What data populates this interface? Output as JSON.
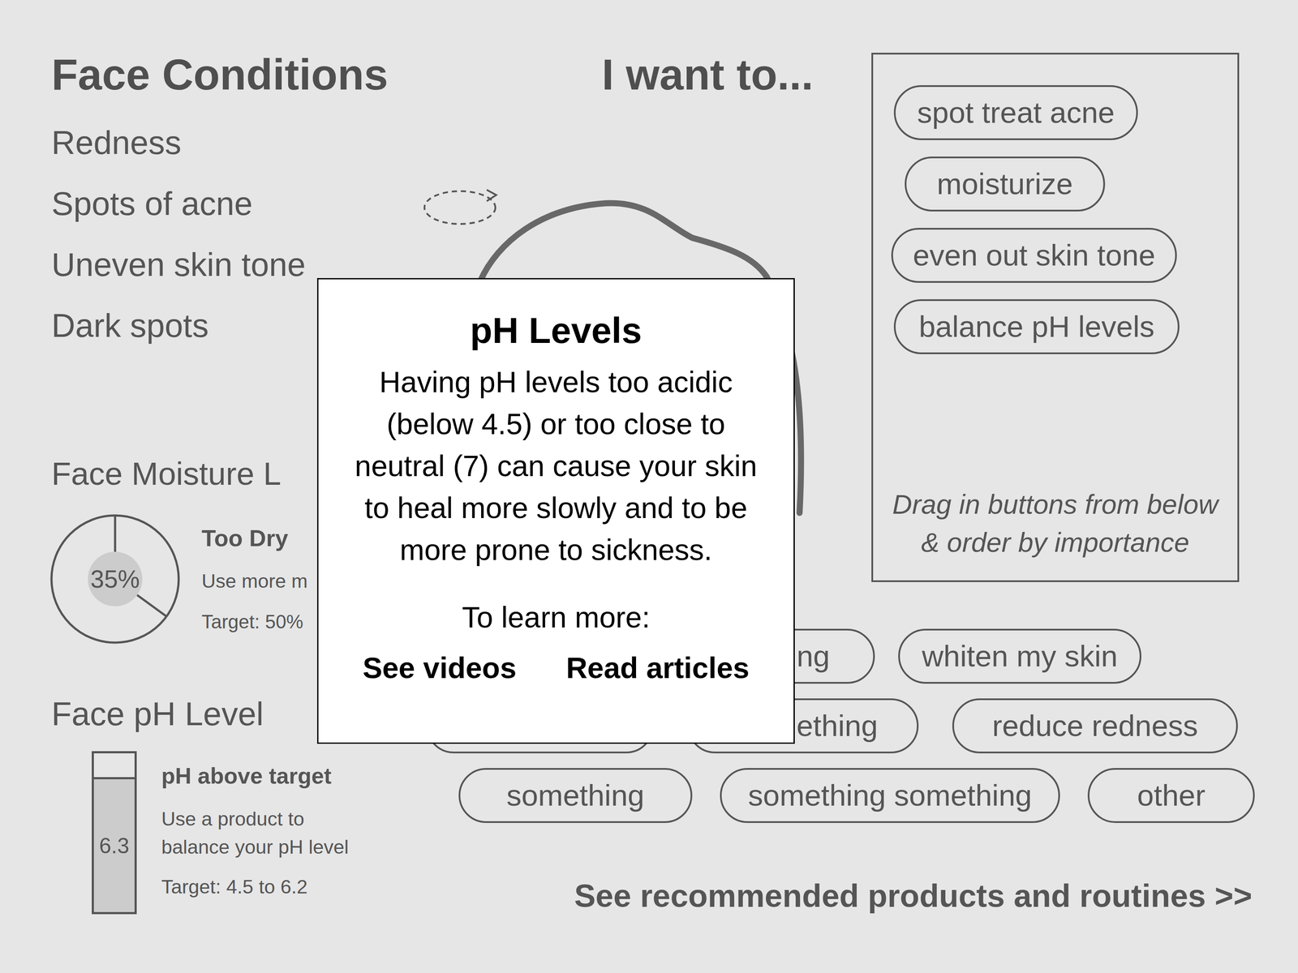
{
  "face_conditions": {
    "title": "Face Conditions",
    "items": [
      "Redness",
      "Spots of acne",
      "Uneven skin tone",
      "Dark spots"
    ]
  },
  "goals": {
    "title": "I want to...",
    "chosen": [
      {
        "label": "spot treat acne"
      },
      {
        "label": "moisturize"
      },
      {
        "label": "even out skin tone"
      },
      {
        "label": "balance pH levels"
      }
    ],
    "hint": [
      "Drag in buttons from below",
      "& order by importance"
    ],
    "options": [
      [
        {
          "label": "ng"
        },
        {
          "label": "whiten my skin"
        }
      ],
      [
        {
          "label": ""
        },
        {
          "label": "ething"
        },
        {
          "label": "reduce redness"
        }
      ],
      [
        {
          "label": "something"
        },
        {
          "label": "something something"
        },
        {
          "label": "other"
        }
      ]
    ],
    "cta": "See recommended products and routines >>"
  },
  "moisture": {
    "title": "Face Moisture L",
    "level": 0.35,
    "reading": "35%",
    "status": "Too Dry",
    "advice": "Use more m",
    "target": "Target: 50%"
  },
  "ph": {
    "title": "Face pH Level",
    "level": 0.85,
    "reading": "6.3",
    "status": "pH above target",
    "advice": [
      "Use a product to",
      "balance your pH level"
    ],
    "target": "Target: 4.5 to 6.2"
  },
  "popup": {
    "title": "pH Levels",
    "body": [
      "Having pH levels too acidic",
      "(below 4.5) or too close to",
      "neutral (7) can cause your skin",
      "to heal more slowly and to be",
      "more prone to sickness."
    ],
    "learn_more": "To learn more:",
    "links": [
      "See videos",
      "Read articles"
    ]
  }
}
